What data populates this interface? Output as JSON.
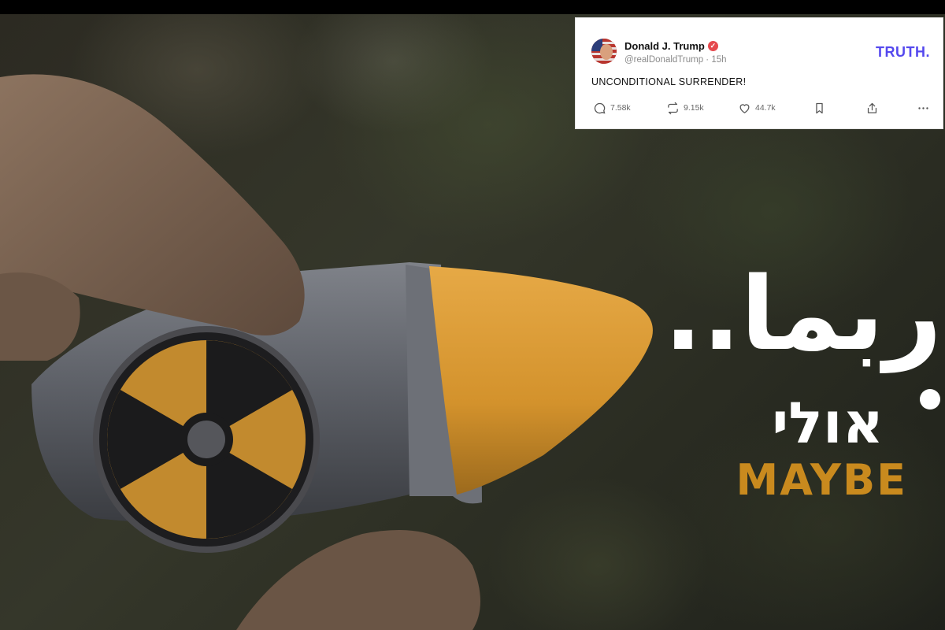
{
  "post": {
    "author_name": "Donald J. Trump",
    "handle": "@realDonaldTrump",
    "separator": "·",
    "time": "15h",
    "brand": "TRUTH.",
    "text": "UNCONDITIONAL SURRENDER!",
    "stats": {
      "replies": "7.58k",
      "retruths": "9.15k",
      "likes": "44.7k"
    }
  },
  "video": {
    "arabic_text": "ربما..",
    "hebrew_text": "אולי",
    "english_text": "MAYBE"
  },
  "colors": {
    "brand": "#5448ee",
    "verified": "#e5484d",
    "maybe_text": "#c98a1e",
    "warhead_tip": "#e0a23a"
  },
  "icons": [
    "verified-badge-icon",
    "reply-icon",
    "retruth-icon",
    "like-icon",
    "bookmark-icon",
    "share-icon",
    "more-icon",
    "radiation-symbol-icon"
  ]
}
